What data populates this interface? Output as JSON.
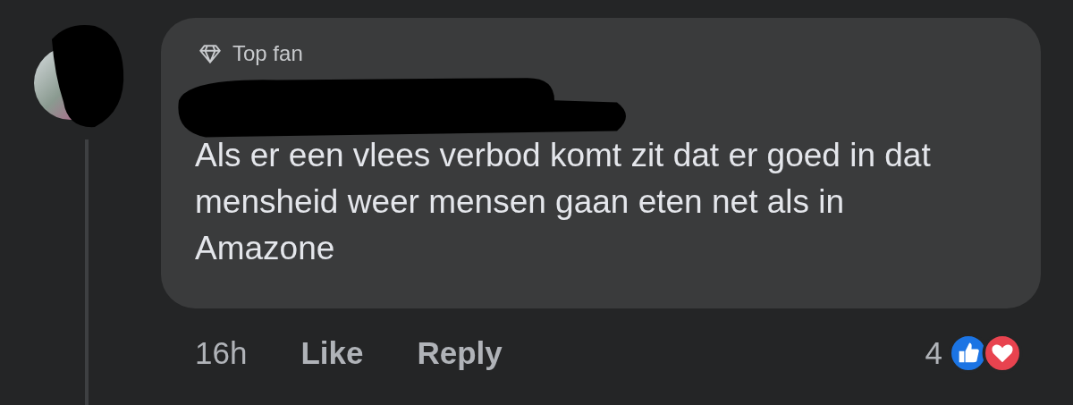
{
  "comment": {
    "badge": "Top fan",
    "author_redacted": true,
    "avatar_redacted": true,
    "text": "Als er een vlees verbod komt zit dat er goed in dat mensheid weer mensen gaan eten net als in Amazone"
  },
  "actions": {
    "time": "16h",
    "buttons": [
      "Like",
      "Reply"
    ]
  },
  "reactions": {
    "count": "4",
    "icons": [
      {
        "kind": "like"
      },
      {
        "kind": "love"
      }
    ]
  }
}
